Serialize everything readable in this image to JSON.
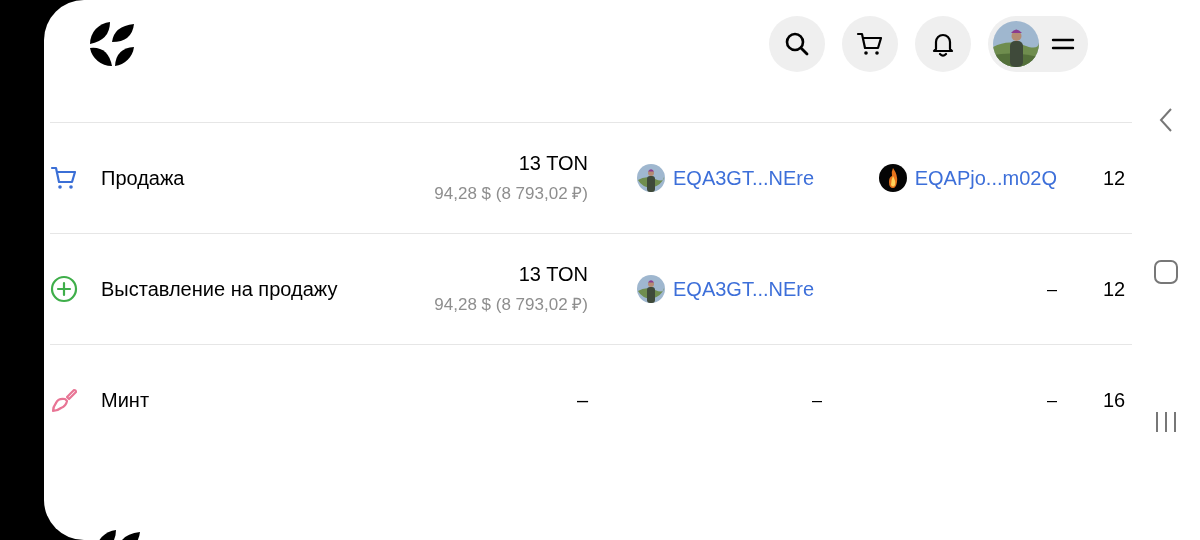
{
  "rows": [
    {
      "kind": "sale",
      "type": "Продажа",
      "price": "13 TON",
      "price_fiat": "94,28 $ (8 793,02 ₽)",
      "from": {
        "address": "EQA3GT...NEre"
      },
      "to": {
        "address": "EQAPjo...m02Q",
        "kind": "flame"
      },
      "date": "12"
    },
    {
      "kind": "listing",
      "type": "Выставление на продажу",
      "price": "13 TON",
      "price_fiat": "94,28 $ (8 793,02 ₽)",
      "from": {
        "address": "EQA3GT...NEre"
      },
      "to": {
        "address": "–",
        "kind": "none"
      },
      "date": "12"
    },
    {
      "kind": "mint",
      "type": "Минт",
      "price": "–",
      "from": {
        "address": "–",
        "kind": "none"
      },
      "to": {
        "address": "–",
        "kind": "none"
      },
      "date": "16"
    }
  ]
}
